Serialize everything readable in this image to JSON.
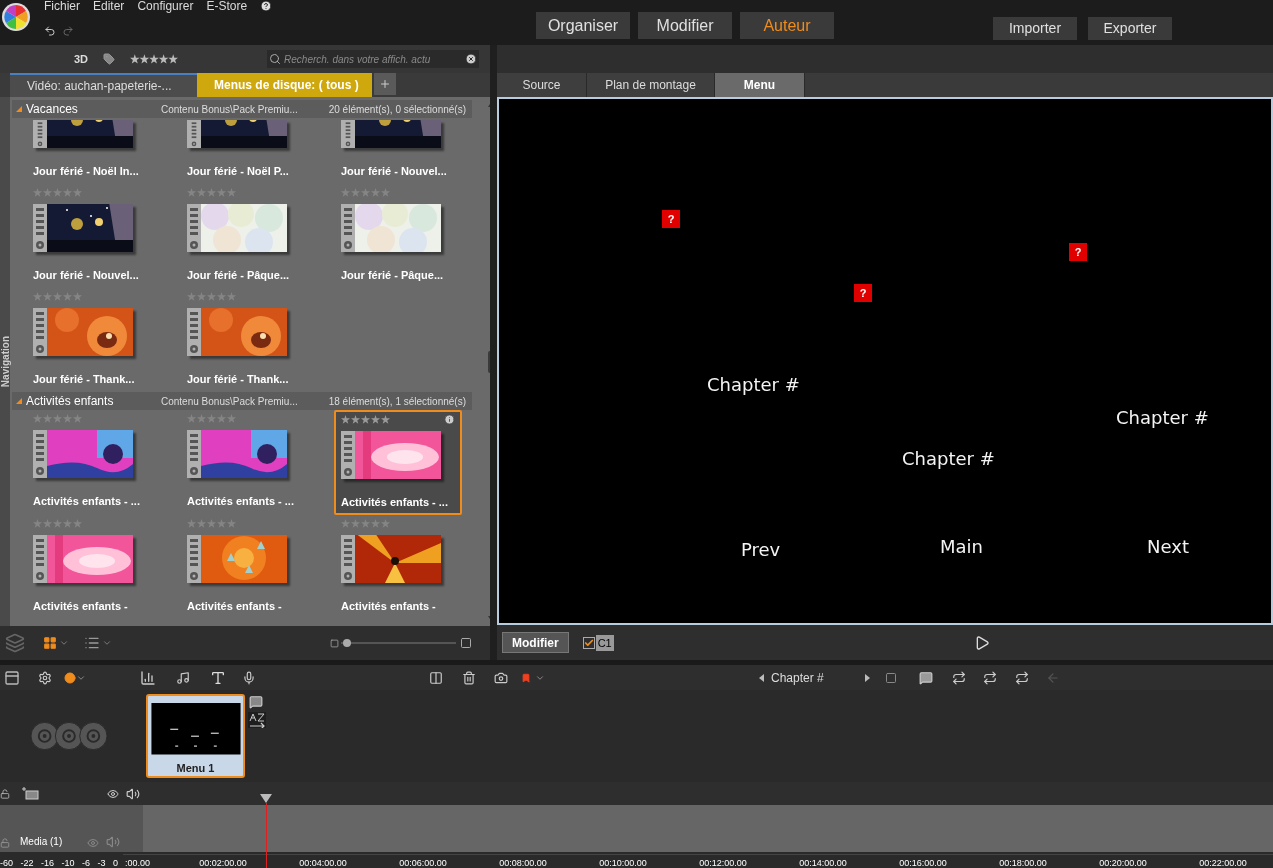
{
  "menu": [
    "Fichier",
    "Editer",
    "Configurer",
    "E-Store"
  ],
  "modes": [
    {
      "label": "Organiser",
      "selected": false
    },
    {
      "label": "Modifier",
      "selected": false
    },
    {
      "label": "Auteur",
      "selected": true
    }
  ],
  "actions": [
    "Importer",
    "Exporter"
  ],
  "library": {
    "filter_label": "3D",
    "search": {
      "placeholder": "Recherch. dans votre affich. actu"
    },
    "tabs": [
      {
        "label": "Vidéo: auchan-papeterie-...",
        "selected": false
      },
      {
        "label": "Menus de disque: ( tous )",
        "selected": true
      }
    ],
    "side_tab": "Navigation",
    "sections": [
      {
        "title": "Vacances",
        "expanded": true,
        "path": "Contenu Bonus\\Pack Premiu...",
        "count": "20 élément(s), 0 sélectionné(s)",
        "items": [
          {
            "title": "Jour férié - Noël In...",
            "selected": false
          },
          {
            "title": "Jour férié - Noël P...",
            "selected": false
          },
          {
            "title": "Jour férié - Nouvel...",
            "selected": false
          },
          {
            "title": "Jour férié - Nouvel...",
            "stars": 0,
            "selected": false
          },
          {
            "title": "Jour férié - Pâque...",
            "stars": 0,
            "selected": false
          },
          {
            "title": "Jour férié - Pâque...",
            "stars": 0,
            "selected": false
          },
          {
            "title": "Jour férié - Thank...",
            "stars": 0,
            "selected": false
          },
          {
            "title": "Jour férié - Thank...",
            "stars": 0,
            "selected": false
          }
        ]
      },
      {
        "title": "Activités enfants",
        "expanded": true,
        "path": "Contenu Bonus\\Pack Premiu...",
        "count": "18 élément(s), 1 sélectionné(s)",
        "items": [
          {
            "title": "Activités enfants - ...",
            "stars": 0,
            "selected": false
          },
          {
            "title": "Activités enfants - ...",
            "stars": 0,
            "selected": false
          },
          {
            "title": "Activités enfants - ...",
            "stars": 0,
            "selected": true
          },
          {
            "title": "Activités enfants -",
            "stars": 0,
            "selected": false
          },
          {
            "title": "Activités enfants -",
            "stars": 0,
            "selected": false
          },
          {
            "title": "Activités enfants -",
            "stars": 0,
            "selected": false
          }
        ]
      }
    ],
    "size_slider": {
      "level": 0.05
    }
  },
  "preview": {
    "tabs": [
      {
        "label": "Source",
        "selected": false
      },
      {
        "label": "Plan de montage",
        "selected": false
      },
      {
        "label": "Menu",
        "selected": true
      }
    ],
    "elements": [
      {
        "kind": "marker",
        "text": "?"
      },
      {
        "kind": "marker",
        "text": "?"
      },
      {
        "kind": "marker",
        "text": "?"
      },
      {
        "kind": "label",
        "text": "Chapter #"
      },
      {
        "kind": "label",
        "text": "Chapter #"
      },
      {
        "kind": "label",
        "text": "Chapter #"
      },
      {
        "kind": "label",
        "text": "Prev"
      },
      {
        "kind": "label",
        "text": "Main"
      },
      {
        "kind": "label",
        "text": "Next"
      }
    ],
    "edit_button": "Modifier",
    "link_checkbox": {
      "checked": true
    },
    "badge": "C1"
  },
  "timeline": {
    "chapter": "Chapter #",
    "menus": [
      {
        "title": "Menu 1",
        "selected": true
      }
    ],
    "tracks": [
      {
        "name": "Media (1)"
      }
    ],
    "meter": [
      "-60",
      "-22",
      "-16",
      "-10",
      "-6",
      "-3",
      "0"
    ],
    "times": [
      ":00.00",
      "00:02:00.00",
      "00:04:00.00",
      "00:06:00.00",
      "00:08:00.00",
      "00:10:00.00",
      "00:12:00.00",
      "00:14:00.00",
      "00:16:00.00",
      "00:18:00.00",
      "00:20:00.00",
      "00:22:00.00"
    ]
  }
}
